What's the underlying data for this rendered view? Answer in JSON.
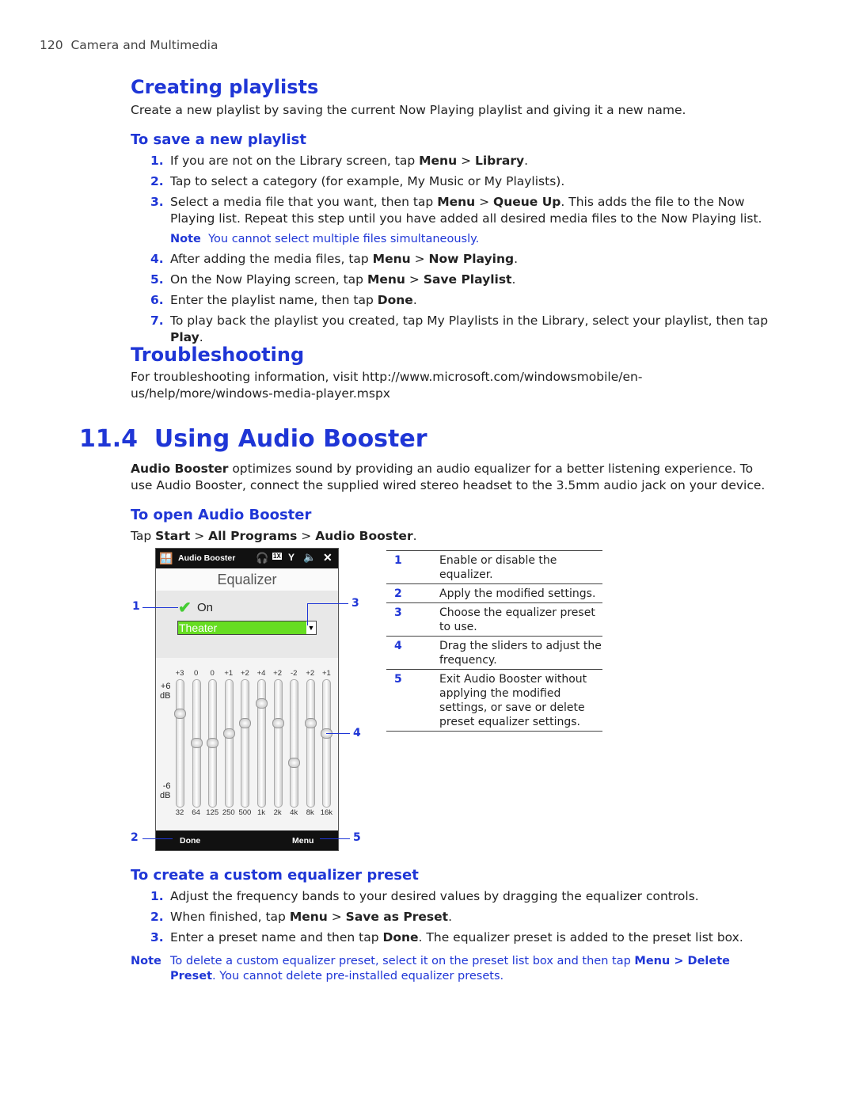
{
  "header": {
    "page_number": "120",
    "section": "Camera and Multimedia"
  },
  "creating": {
    "title": "Creating playlists",
    "intro": "Create a new playlist by saving the current Now Playing playlist and giving it a new name.",
    "sub": "To save a new playlist",
    "steps": [
      {
        "n": "1.",
        "html": "If you are not on the Library screen, tap <b>Menu</b> &gt; <b>Library</b>."
      },
      {
        "n": "2.",
        "html": "Tap to select a category (for example, My Music or My Playlists)."
      },
      {
        "n": "3.",
        "html": "Select a media file that you want, then tap <b>Menu</b> &gt; <b>Queue Up</b>. This adds the file to the Now Playing list. Repeat this step until you have added all desired media files to the Now Playing list."
      },
      {
        "n": "4.",
        "html": "After adding the media files, tap <b>Menu</b> &gt; <b>Now Playing</b>."
      },
      {
        "n": "5.",
        "html": "On the Now Playing screen, tap <b>Menu</b> &gt; <b>Save Playlist</b>."
      },
      {
        "n": "6.",
        "html": "Enter the playlist name, then tap <b>Done</b>."
      },
      {
        "n": "7.",
        "html": "To play back the playlist you created, tap My Playlists in the Library, select your playlist, then tap <b>Play</b>."
      }
    ],
    "note_label": "Note",
    "note_text": "You cannot select multiple files simultaneously."
  },
  "trouble": {
    "title": "Troubleshooting",
    "text": "For troubleshooting information, visit http://www.microsoft.com/windowsmobile/en-us/help/more/windows-media-player.mspx"
  },
  "booster": {
    "number": "11.4",
    "title": "Using Audio Booster",
    "intro": "<b>Audio Booster</b> optimizes sound by providing an audio equalizer for a better listening experience. To use Audio Booster, connect the supplied wired stereo headset to the 3.5mm audio jack on your device.",
    "open_title": "To open Audio Booster",
    "open_text": "Tap <b>Start</b> &gt; <b>All Programs</b> &gt; <b>Audio Booster</b>.",
    "custom_title": "To create a custom equalizer preset",
    "custom_steps": [
      {
        "n": "1.",
        "html": "Adjust the frequency bands to your desired values by dragging the equalizer controls."
      },
      {
        "n": "2.",
        "html": "When finished, tap <b>Menu</b> &gt; <b>Save as Preset</b>."
      },
      {
        "n": "3.",
        "html": "Enter a preset name and then tap <b>Done</b>. The equalizer preset is added to the preset list box."
      }
    ],
    "note_label": "Note",
    "note_html": "To delete a custom equalizer preset, select it on the preset list box and then tap <b>Menu &gt; Delete Preset</b>. You cannot delete pre-installed equalizer presets."
  },
  "phone": {
    "app_title": "Audio Booster",
    "screen_title": "Equalizer",
    "toggle_label": "On",
    "toggle_checked": true,
    "preset": "Theater",
    "max_label": "+6\ndB",
    "min_label": "-6\ndB",
    "bands": [
      {
        "freq": "32",
        "value": 3
      },
      {
        "freq": "64",
        "value": 0
      },
      {
        "freq": "125",
        "value": 0
      },
      {
        "freq": "250",
        "value": 1
      },
      {
        "freq": "500",
        "value": 2
      },
      {
        "freq": "1k",
        "value": 4
      },
      {
        "freq": "2k",
        "value": 2
      },
      {
        "freq": "4k",
        "value": -2
      },
      {
        "freq": "8k",
        "value": 2
      },
      {
        "freq": "16k",
        "value": 1
      }
    ],
    "left_softkey": "Done",
    "right_softkey": "Menu",
    "preset_color": "#66dd22"
  },
  "callouts": [
    {
      "n": "1",
      "text": "Enable or disable the equalizer."
    },
    {
      "n": "2",
      "text": "Apply the modified settings."
    },
    {
      "n": "3",
      "text": "Choose the equalizer preset to use."
    },
    {
      "n": "4",
      "text": "Drag the sliders to adjust the frequency."
    },
    {
      "n": "5",
      "text": "Exit Audio Booster without applying the modified settings, or save or delete preset equalizer settings."
    }
  ]
}
